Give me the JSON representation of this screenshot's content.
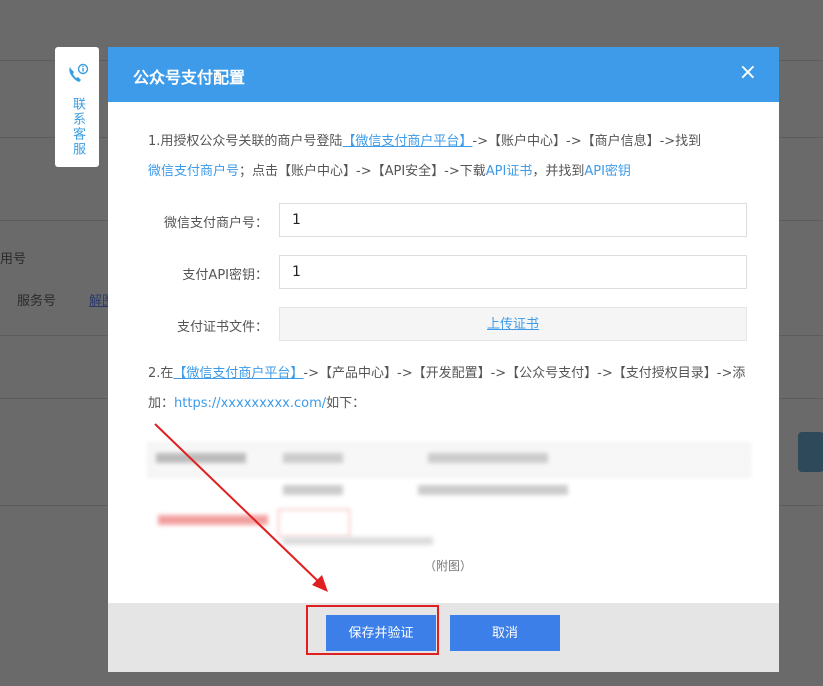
{
  "background": {
    "text_left_1": "用号",
    "text_left_2": "服务号",
    "link_left": "解图"
  },
  "contact": {
    "label": "联系客服"
  },
  "modal": {
    "title": "公众号支付配置",
    "close": "×",
    "step1": {
      "prefix": "1.用授权公众号关联的商户号登陆",
      "platform_link": "【微信支付商户平台】",
      "middle": "->【账户中心】->【商户信息】->找到",
      "merchant_link": "微信支付商户号",
      "after_merchant": "；点击【账户中心】->【API安全】->下载",
      "cert_link": "API证书",
      "after_cert": "，并找到",
      "key_link": "API密钥"
    },
    "fields": {
      "merchant_label": "微信支付商户号：",
      "merchant_value": "1",
      "key_label": "支付API密钥：",
      "key_value": "1",
      "cert_label": "支付证书文件：",
      "upload_label": "上传证书"
    },
    "step2": {
      "prefix": "2.在",
      "platform_link": "【微信支付商户平台】",
      "middle": "->【产品中心】->【开发配置】->【公众号支付】->【支付授权目录】->添加：",
      "url_link": "https://xxxxxxxxx.com/",
      "suffix": "如下："
    },
    "attachment_caption": "（附图）",
    "buttons": {
      "save": "保存并验证",
      "cancel": "取消"
    }
  },
  "colors": {
    "header": "#3d9be9",
    "button": "#3d7fe9",
    "highlight": "#e02020"
  }
}
